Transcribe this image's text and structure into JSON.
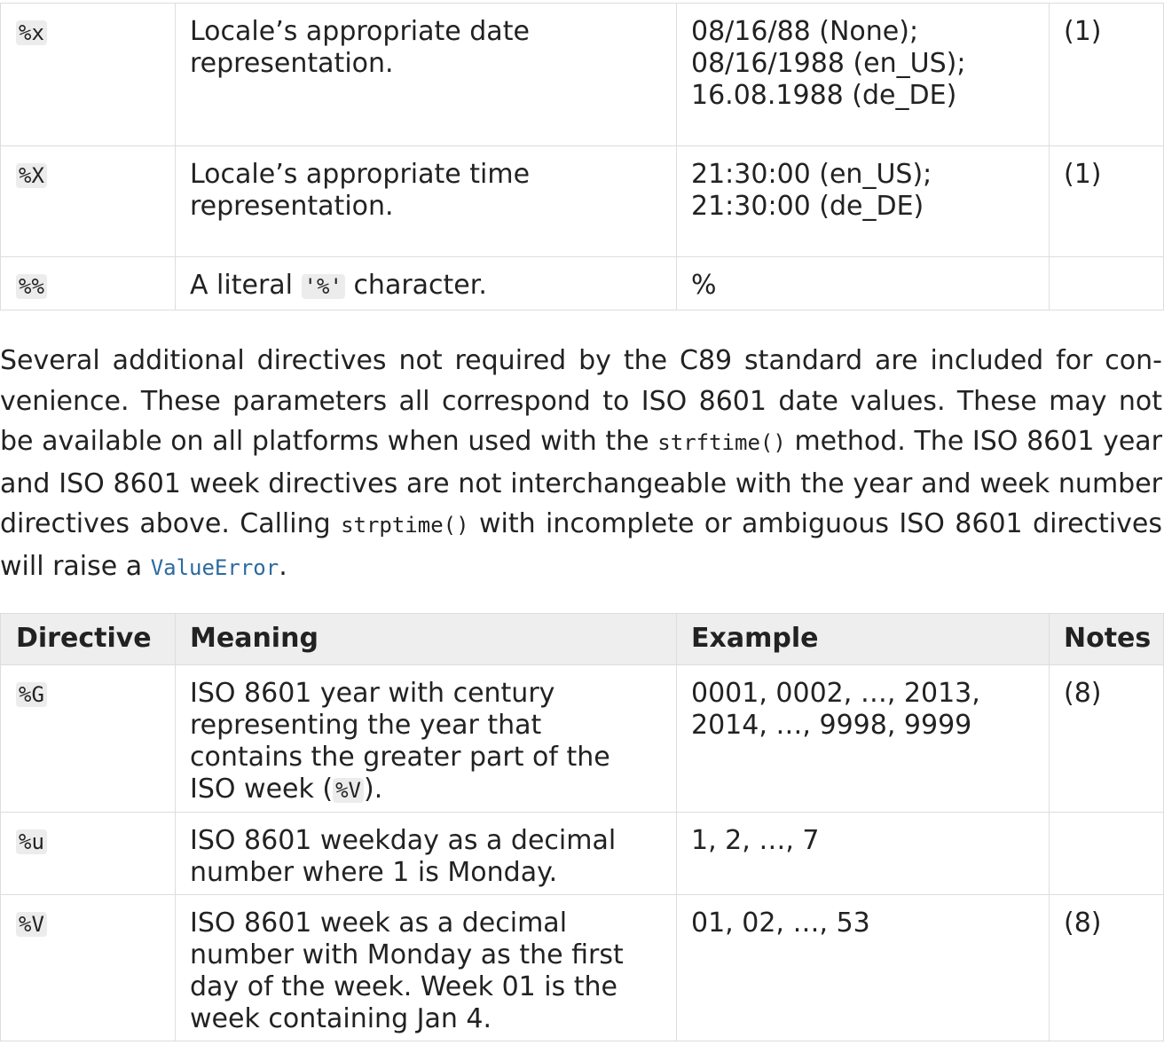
{
  "top_table": {
    "rows": [
      {
        "directive": "%x",
        "meaning": [
          "Locale’s appropriate date",
          "representation."
        ],
        "example": [
          "08/16/88 (None);",
          "08/16/1988 (en_US);",
          "16.08.1988 (de_DE)"
        ],
        "notes": "(1)"
      },
      {
        "directive": "%X",
        "meaning": [
          "Locale’s appropriate time",
          "representation."
        ],
        "example": [
          "21:30:00 (en_US);",
          "21:30:00 (de_DE)"
        ],
        "notes": "(1)"
      },
      {
        "directive": "%%",
        "meaning_prefix": "A literal ",
        "meaning_code": "'%'",
        "meaning_suffix": " character.",
        "example": [
          "%"
        ],
        "notes": ""
      }
    ]
  },
  "paragraph": {
    "text1": "Several additional directives not required by the C89 standard are included for con­venience. These parameters all correspond to ISO 8601 date values. These may not be available on all platforms when used with the ",
    "code1": "strftime()",
    "text2": " method. The ISO 8601 year and ISO 8601 week directives are not interchangeable with the year and week number directives above. Calling ",
    "code2": "strptime()",
    "text3": " with incomplete or ambiguous ISO 8601 directives will raise a ",
    "link": "ValueError",
    "text4": "."
  },
  "iso_table": {
    "headers": {
      "directive": "Directive",
      "meaning": "Meaning",
      "example": "Example",
      "notes": "Notes"
    },
    "rows": [
      {
        "directive": "%G",
        "meaning": [
          "ISO 8601 year with century",
          "representing the year that",
          "contains the greater part of the"
        ],
        "meaning_last_prefix": "ISO week (",
        "meaning_last_code": "%V",
        "meaning_last_suffix": ").",
        "example": [
          "0001, 0002, …, 2013,",
          "2014, …, 9998, 9999"
        ],
        "notes": "(8)"
      },
      {
        "directive": "%u",
        "meaning": [
          "ISO 8601 weekday as a decimal",
          "number where 1 is Monday."
        ],
        "example": [
          "1, 2, …, 7"
        ],
        "notes": ""
      },
      {
        "directive": "%V",
        "meaning": [
          "ISO 8601 week as a decimal",
          "number with Monday as the first",
          "day of the week. Week 01 is the",
          "week containing Jan 4."
        ],
        "example": [
          "01, 02, …, 53"
        ],
        "notes": "(8)"
      }
    ]
  }
}
